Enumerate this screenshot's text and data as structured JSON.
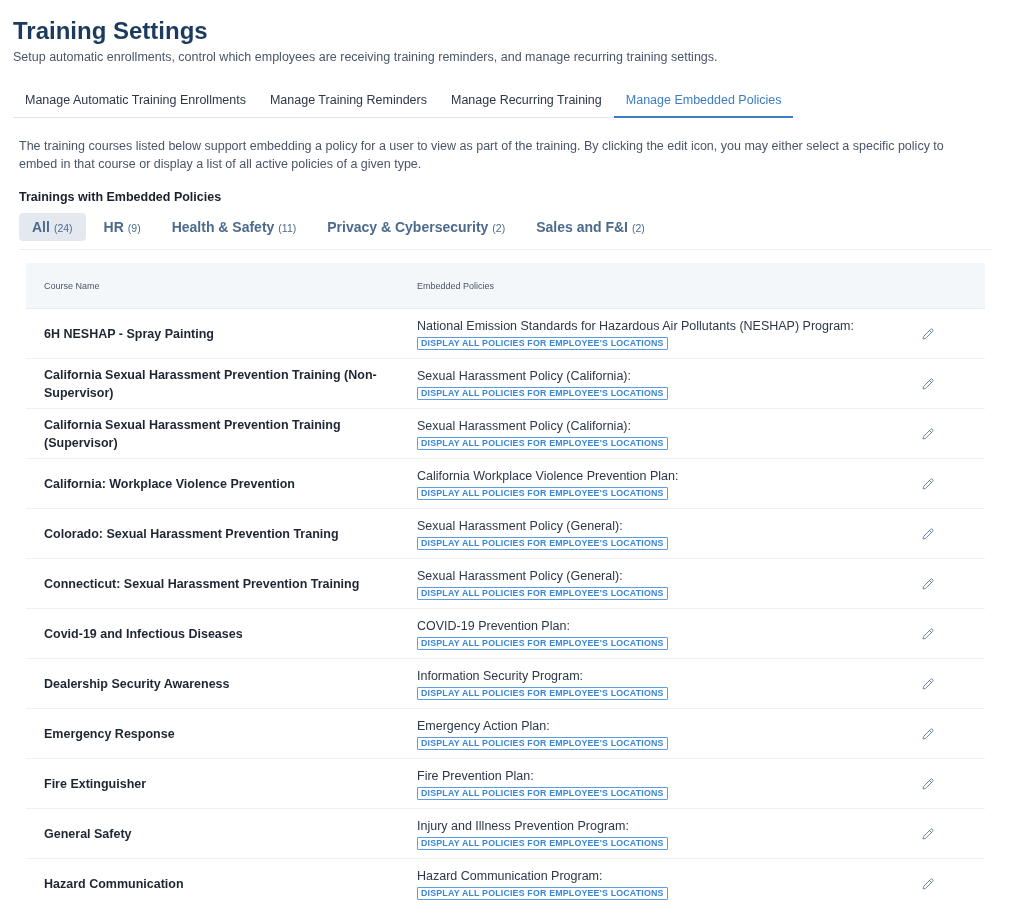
{
  "page": {
    "title": "Training Settings",
    "subtitle": "Setup automatic enrollments, control which employees are receiving training reminders, and manage recurring training settings."
  },
  "tabs": [
    {
      "label": "Manage Automatic Training Enrollments",
      "selected": false
    },
    {
      "label": "Manage Training Reminders",
      "selected": false
    },
    {
      "label": "Manage Recurring Training",
      "selected": false
    },
    {
      "label": "Manage Embedded Policies",
      "selected": true
    }
  ],
  "description": "The training courses listed below support embedding a policy for a user to view as part of the training. By clicking the edit icon, you may either select a specific policy to embed in that course or display a list of all active policies of a given type.",
  "section_title": "Trainings with Embedded Policies",
  "filters": [
    {
      "label": "All",
      "count": "(24)",
      "selected": true
    },
    {
      "label": "HR",
      "count": "(9)",
      "selected": false
    },
    {
      "label": "Health & Safety",
      "count": "(11)",
      "selected": false
    },
    {
      "label": "Privacy & Cybersecurity",
      "count": "(2)",
      "selected": false
    },
    {
      "label": "Sales and F&I",
      "count": "(2)",
      "selected": false
    }
  ],
  "table": {
    "columns": [
      "Course Name",
      "Embedded Policies"
    ],
    "rows": [
      {
        "course": "6H NESHAP - Spray Painting",
        "policy": "National Emission Standards for Hazardous Air Pollutants (NESHAP) Program:",
        "tag": "DISPLAY ALL POLICIES FOR EMPLOYEE'S LOCATIONS"
      },
      {
        "course": "California Sexual Harassment Prevention Training (Non-Supervisor)",
        "policy": "Sexual Harassment Policy (California):",
        "tag": "DISPLAY ALL POLICIES FOR EMPLOYEE'S LOCATIONS"
      },
      {
        "course": "California Sexual Harassment Prevention Training (Supervisor)",
        "policy": "Sexual Harassment Policy (California):",
        "tag": "DISPLAY ALL POLICIES FOR EMPLOYEE'S LOCATIONS"
      },
      {
        "course": "California: Workplace Violence Prevention",
        "policy": "California Workplace Violence Prevention Plan:",
        "tag": "DISPLAY ALL POLICIES FOR EMPLOYEE'S LOCATIONS"
      },
      {
        "course": "Colorado: Sexual Harassment Prevention Traning",
        "policy": "Sexual Harassment Policy (General):",
        "tag": "DISPLAY ALL POLICIES FOR EMPLOYEE'S LOCATIONS"
      },
      {
        "course": "Connecticut: Sexual Harassment Prevention Training",
        "policy": "Sexual Harassment Policy (General):",
        "tag": "DISPLAY ALL POLICIES FOR EMPLOYEE'S LOCATIONS"
      },
      {
        "course": "Covid-19 and Infectious Diseases",
        "policy": "COVID-19 Prevention Plan:",
        "tag": "DISPLAY ALL POLICIES FOR EMPLOYEE'S LOCATIONS"
      },
      {
        "course": "Dealership Security Awareness",
        "policy": "Information Security Program:",
        "tag": "DISPLAY ALL POLICIES FOR EMPLOYEE'S LOCATIONS"
      },
      {
        "course": "Emergency Response",
        "policy": "Emergency Action Plan:",
        "tag": "DISPLAY ALL POLICIES FOR EMPLOYEE'S LOCATIONS"
      },
      {
        "course": "Fire Extinguisher",
        "policy": "Fire Prevention Plan:",
        "tag": "DISPLAY ALL POLICIES FOR EMPLOYEE'S LOCATIONS"
      },
      {
        "course": "General Safety",
        "policy": "Injury and Illness Prevention Program:",
        "tag": "DISPLAY ALL POLICIES FOR EMPLOYEE'S LOCATIONS"
      },
      {
        "course": "Hazard Communication",
        "policy": "Hazard Communication Program:",
        "tag": "DISPLAY ALL POLICIES FOR EMPLOYEE'S LOCATIONS"
      }
    ]
  }
}
